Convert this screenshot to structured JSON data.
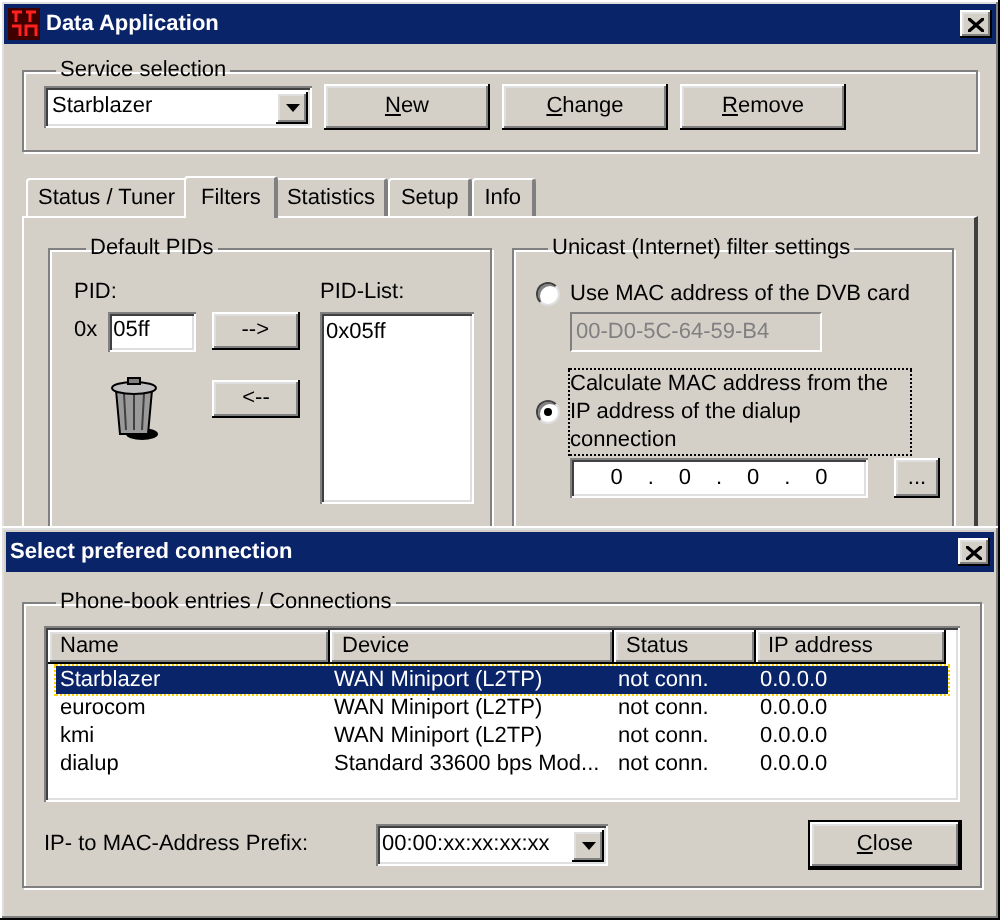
{
  "main_window": {
    "title": "Data Application",
    "service_selection": {
      "title": "Service selection",
      "value": "Starblazer",
      "buttons": [
        {
          "label": "New",
          "mnemonic_first": true
        },
        {
          "label": "Change",
          "mnemonic_first": true
        },
        {
          "label": "Remove",
          "mnemonic_first": true
        }
      ]
    },
    "tabs": [
      {
        "label": "Status / Tuner",
        "selected": false
      },
      {
        "label": "Filters",
        "selected": true
      },
      {
        "label": "Statistics",
        "selected": false
      },
      {
        "label": "Setup",
        "selected": false
      },
      {
        "label": "Info",
        "selected": false
      }
    ],
    "default_pids": {
      "title": "Default PIDs",
      "pid_label": "PID:",
      "prefix": "0x",
      "pid_value": "05ff",
      "add_button": "-->",
      "remove_button": "<--",
      "list_label": "PID-List:",
      "list_items": [
        "0x05ff"
      ]
    },
    "unicast": {
      "title": "Unicast (Internet) filter settings",
      "options": [
        {
          "label": "Use MAC address of the DVB card",
          "selected": false,
          "focused": false
        },
        {
          "label": "Calculate MAC address from the IP address of the dialup connection",
          "selected": true,
          "focused": true
        }
      ],
      "mac_address": {
        "value": "00-D0-5C-64-59-B4",
        "disabled": true
      },
      "ip_parts": [
        "0",
        ".",
        "0",
        ".",
        "0",
        ".",
        "0"
      ],
      "browse_button": "..."
    }
  },
  "dialog": {
    "title": "Select prefered connection",
    "group_title": "Phone-book entries / Connections",
    "columns": [
      "Name",
      "Device",
      "Status",
      "IP address"
    ],
    "rows": [
      {
        "cells": [
          "Starblazer",
          "WAN Miniport (L2TP)",
          "not conn.",
          "0.0.0.0"
        ],
        "selected": true
      },
      {
        "cells": [
          "eurocom",
          "WAN Miniport (L2TP)",
          "not conn.",
          "0.0.0.0"
        ],
        "selected": false
      },
      {
        "cells": [
          "kmi",
          "WAN Miniport (L2TP)",
          "not conn.",
          "0.0.0.0"
        ],
        "selected": false
      },
      {
        "cells": [
          "dialup",
          "Standard 33600 bps Mod...",
          "not conn.",
          "0.0.0.0"
        ],
        "selected": false
      }
    ],
    "prefix_label": "IP- to MAC-Address Prefix:",
    "prefix_value": "00:00:xx:xx:xx:xx",
    "close_button": {
      "label": "Close",
      "mnemonic_first": true
    }
  }
}
